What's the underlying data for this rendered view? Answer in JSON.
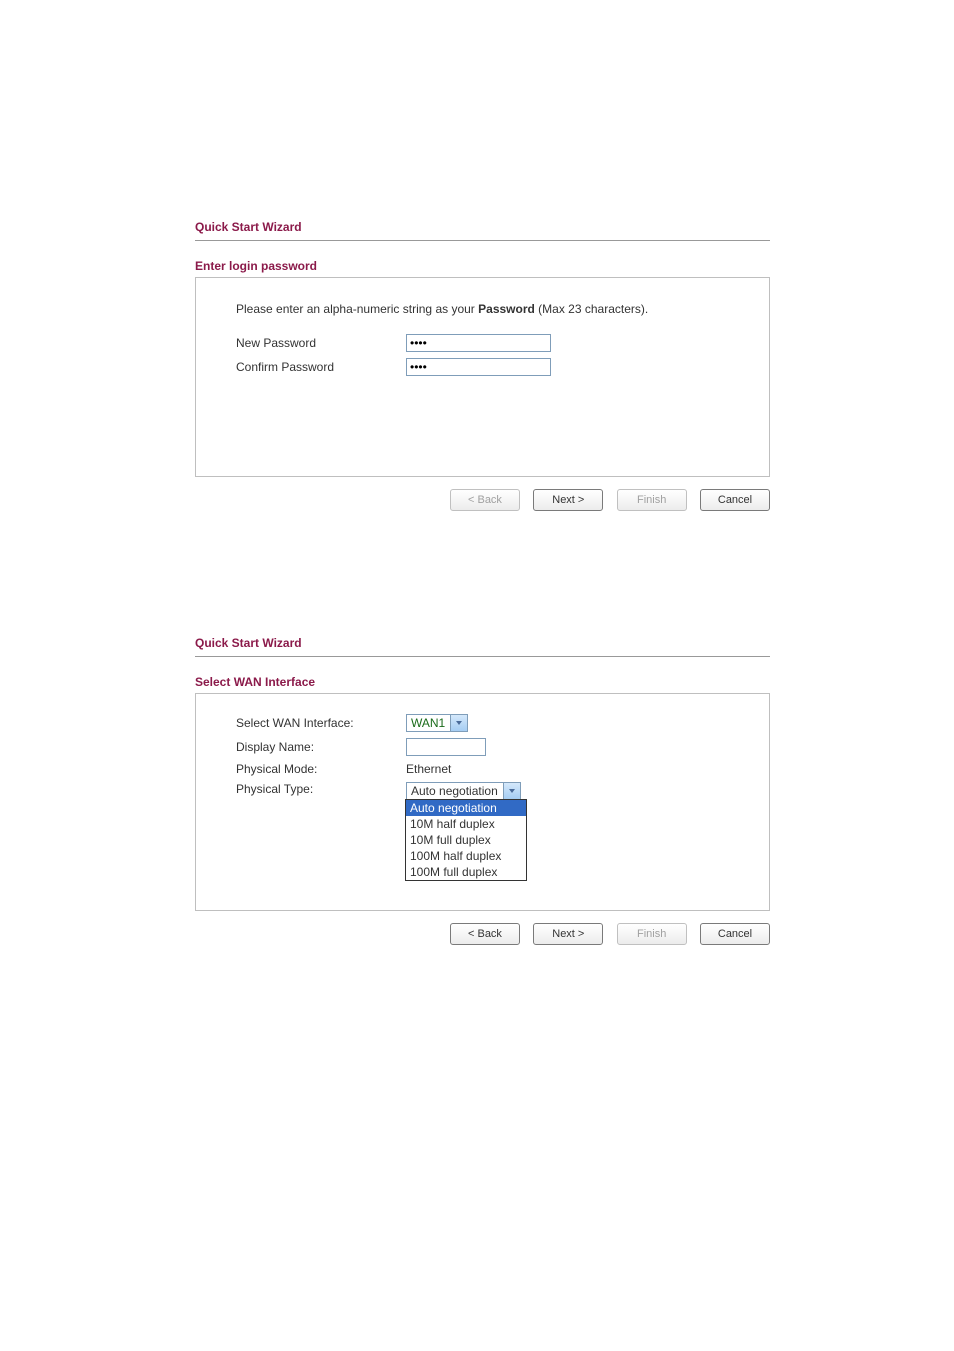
{
  "panel1": {
    "wizard_title": "Quick Start Wizard",
    "section_title": "Enter login password",
    "instruction_pre": "Please enter an alpha-numeric string as your ",
    "instruction_bold": "Password",
    "instruction_post": " (Max 23 characters).",
    "new_password_label": "New Password",
    "new_password_value": "••••",
    "confirm_password_label": "Confirm Password",
    "confirm_password_value": "••••",
    "buttons": {
      "back": "< Back",
      "next": "Next >",
      "finish": "Finish",
      "cancel": "Cancel"
    }
  },
  "panel2": {
    "wizard_title": "Quick Start Wizard",
    "section_title": "Select WAN Interface",
    "select_wan_label": "Select WAN Interface:",
    "select_wan_value": "WAN1",
    "display_name_label": "Display Name:",
    "display_name_value": "",
    "physical_mode_label": "Physical Mode:",
    "physical_mode_value": "Ethernet",
    "physical_type_label": "Physical Type:",
    "physical_type_value": "Auto negotiation",
    "physical_type_options": [
      "Auto negotiation",
      "10M half duplex",
      "10M full duplex",
      "100M half duplex",
      "100M full duplex"
    ],
    "buttons": {
      "back": "< Back",
      "next": "Next >",
      "finish": "Finish",
      "cancel": "Cancel"
    }
  }
}
